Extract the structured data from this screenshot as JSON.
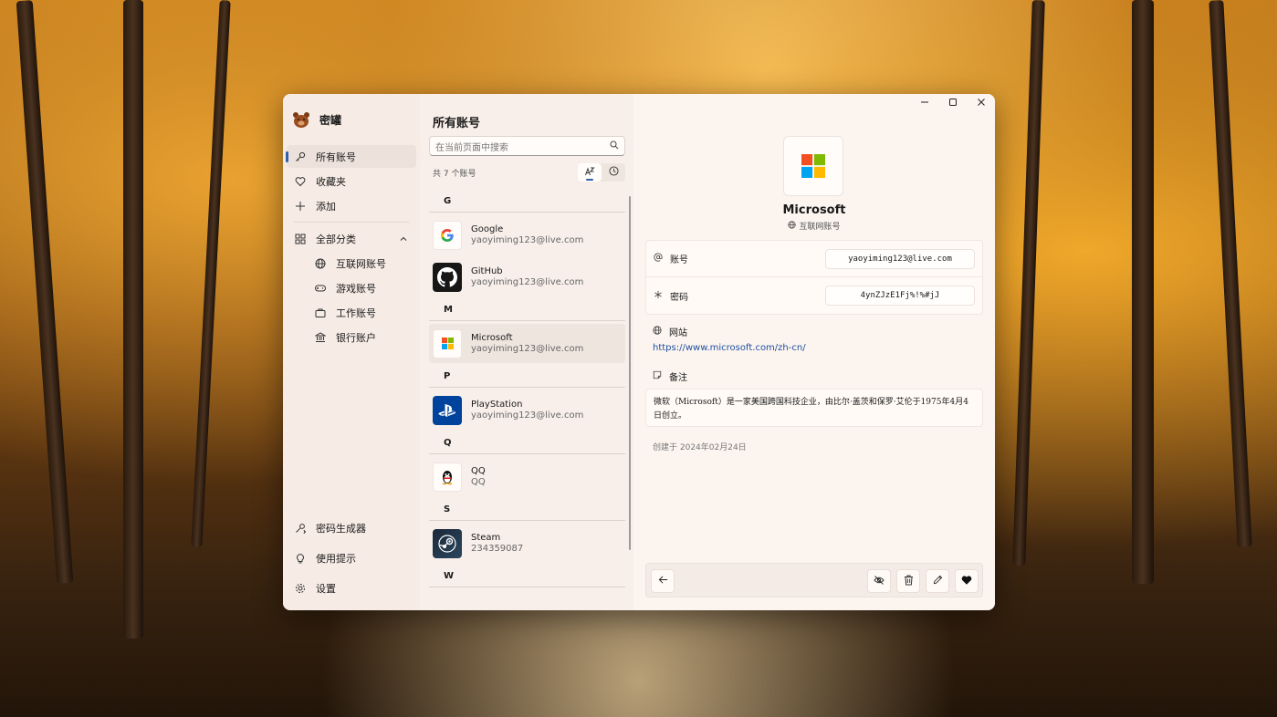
{
  "app": {
    "title": "密罐"
  },
  "sidebar": {
    "items": [
      {
        "label": "所有账号",
        "icon": "key-icon"
      },
      {
        "label": "收藏夹",
        "icon": "heart-icon"
      },
      {
        "label": "添加",
        "icon": "plus-icon"
      }
    ],
    "category_header": {
      "label": "全部分类",
      "icon": "grid-icon"
    },
    "categories": [
      {
        "label": "互联网账号",
        "icon": "globe-icon"
      },
      {
        "label": "游戏账号",
        "icon": "gamepad-icon"
      },
      {
        "label": "工作账号",
        "icon": "briefcase-icon"
      },
      {
        "label": "银行账户",
        "icon": "bank-icon"
      }
    ],
    "bottom": [
      {
        "label": "密码生成器",
        "icon": "password-generator-icon"
      },
      {
        "label": "使用提示",
        "icon": "lightbulb-icon"
      },
      {
        "label": "设置",
        "icon": "gear-icon"
      }
    ]
  },
  "list": {
    "title": "所有账号",
    "search_placeholder": "在当前页面中搜索",
    "count_text": "共 7 个账号",
    "groups": [
      {
        "letter": "G",
        "accounts": [
          {
            "name": "Google",
            "sub": "yaoyiming123@live.com"
          },
          {
            "name": "GitHub",
            "sub": "yaoyiming123@live.com"
          }
        ]
      },
      {
        "letter": "M",
        "accounts": [
          {
            "name": "Microsoft",
            "sub": "yaoyiming123@live.com"
          }
        ]
      },
      {
        "letter": "P",
        "accounts": [
          {
            "name": "PlayStation",
            "sub": "yaoyiming123@live.com"
          }
        ]
      },
      {
        "letter": "Q",
        "accounts": [
          {
            "name": "QQ",
            "sub": "QQ"
          }
        ]
      },
      {
        "letter": "S",
        "accounts": [
          {
            "name": "Steam",
            "sub": "234359087"
          }
        ]
      },
      {
        "letter": "W",
        "accounts": []
      }
    ]
  },
  "detail": {
    "name": "Microsoft",
    "category": "互联网账号",
    "account_label": "账号",
    "account_value": "yaoyiming123@live.com",
    "password_label": "密码",
    "password_value": "4ynZJzE1Fj%!%#jJ",
    "website_label": "网站",
    "website_url": "https://www.microsoft.com/zh-cn/",
    "note_label": "备注",
    "note_text": "微软（Microsoft）是一家美国跨国科技企业，由比尔·盖茨和保罗·艾伦于1975年4月4日创立。",
    "created_text": "创建于 2024年02月24日"
  },
  "colors": {
    "accent": "#2f5fae",
    "link": "#1f4f9f",
    "ms_red": "#f25022",
    "ms_green": "#7fba00",
    "ms_blue": "#00a4ef",
    "ms_yellow": "#ffb900"
  }
}
